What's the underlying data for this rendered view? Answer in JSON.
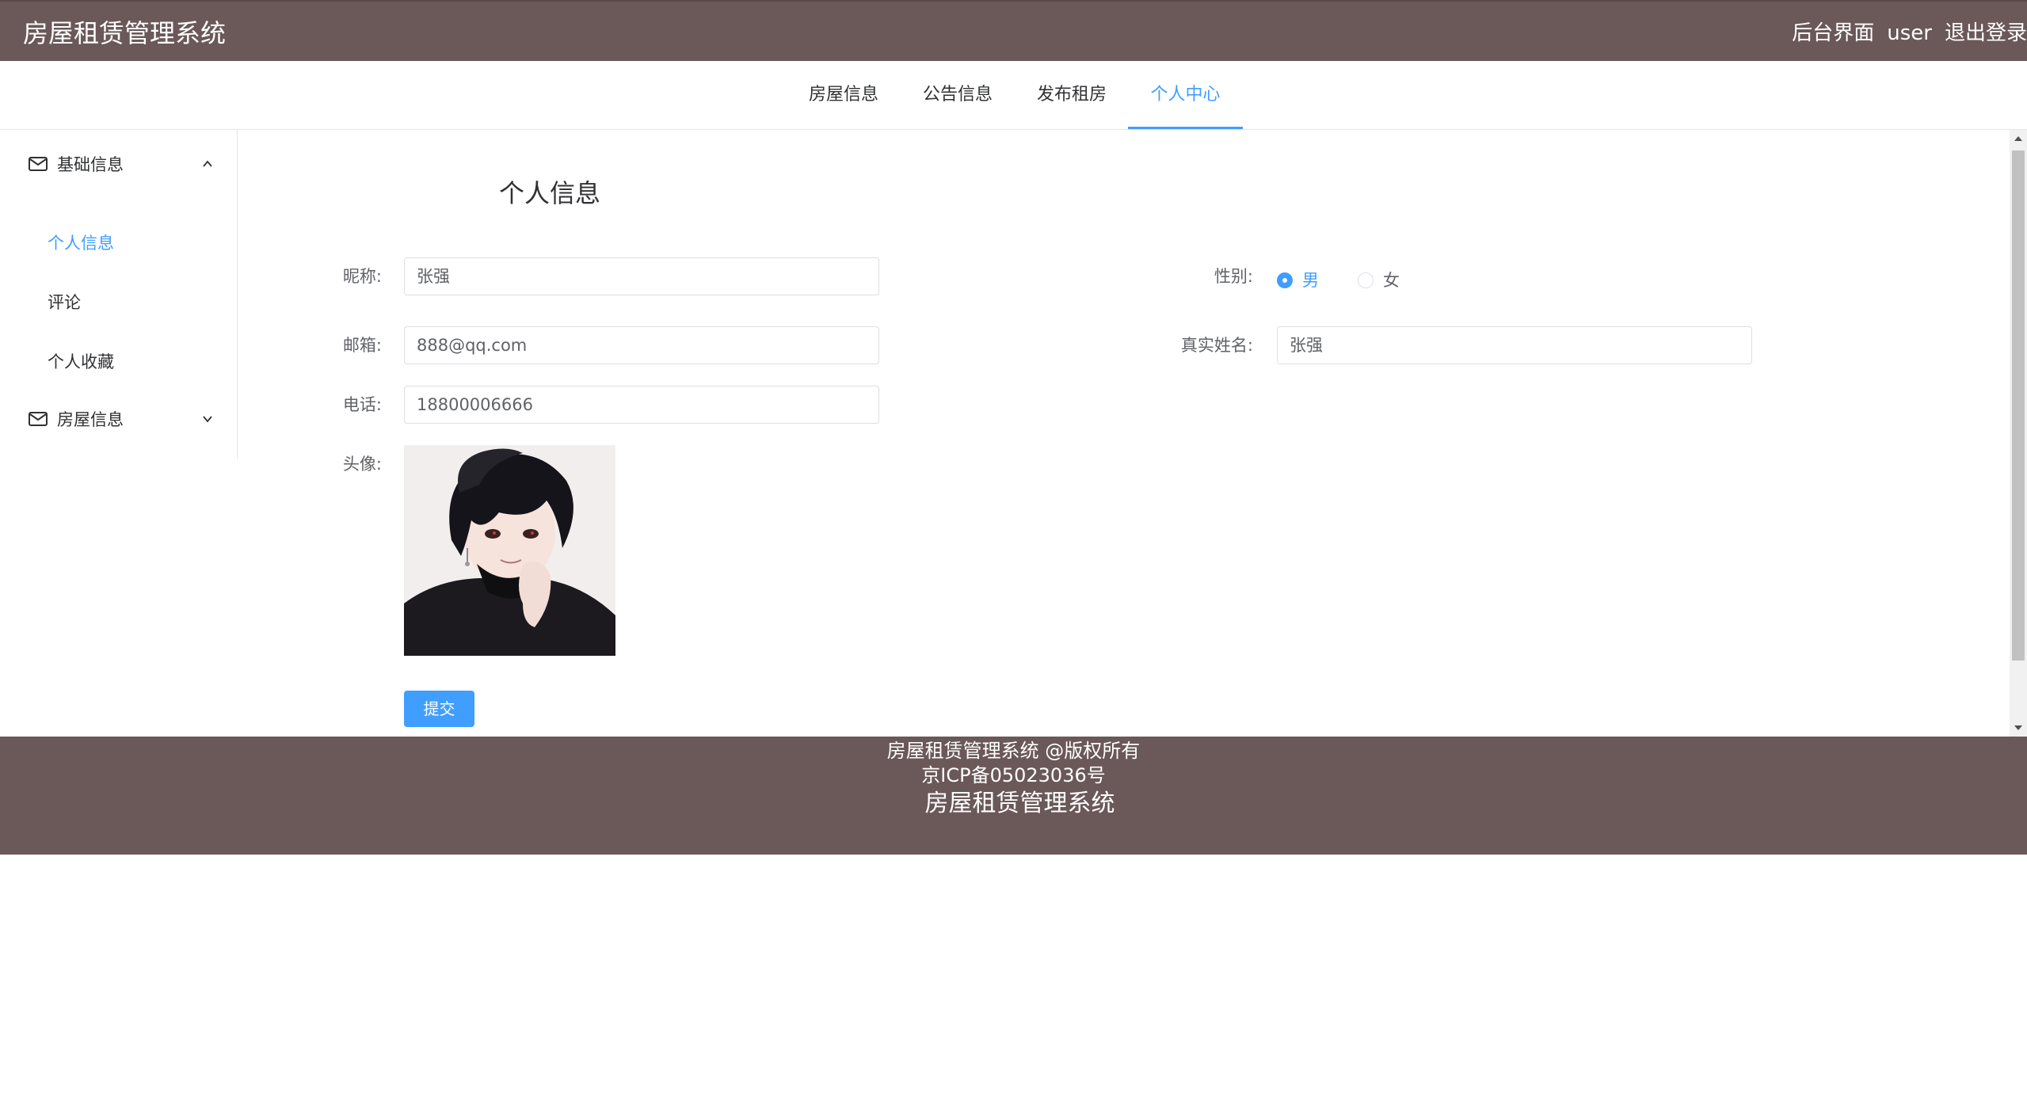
{
  "header": {
    "app_title": "房屋租赁管理系统",
    "admin_link": "后台界面",
    "username": "user",
    "logout": "退出登录"
  },
  "nav": {
    "tabs": [
      {
        "label": "房屋信息"
      },
      {
        "label": "公告信息"
      },
      {
        "label": "发布租房"
      },
      {
        "label": "个人中心",
        "active": true
      }
    ]
  },
  "sidebar": {
    "groups": [
      {
        "label": "基础信息",
        "icon": "mail-icon",
        "expanded": true,
        "items": [
          {
            "label": "个人信息",
            "active": true
          },
          {
            "label": "评论"
          },
          {
            "label": "个人收藏"
          }
        ]
      },
      {
        "label": "房屋信息",
        "icon": "mail-icon",
        "expanded": false
      }
    ]
  },
  "form": {
    "title": "个人信息",
    "nickname": {
      "label": "昵称:",
      "value": "张强"
    },
    "gender": {
      "label": "性别:",
      "options": [
        "男",
        "女"
      ],
      "selected": "男"
    },
    "email": {
      "label": "邮箱:",
      "value": "888@qq.com"
    },
    "real_name": {
      "label": "真实姓名:",
      "value": "张强"
    },
    "phone": {
      "label": "电话:",
      "value": "18800006666"
    },
    "avatar": {
      "label": "头像:"
    },
    "submit": "提交"
  },
  "footer": {
    "line1": "房屋租赁管理系统 @版权所有",
    "line2": "京ICP备05023036号",
    "line3": "房屋租赁管理系统"
  },
  "colors": {
    "header_bg": "#6b5858",
    "accent": "#409eff",
    "border": "#dcdfe6"
  }
}
